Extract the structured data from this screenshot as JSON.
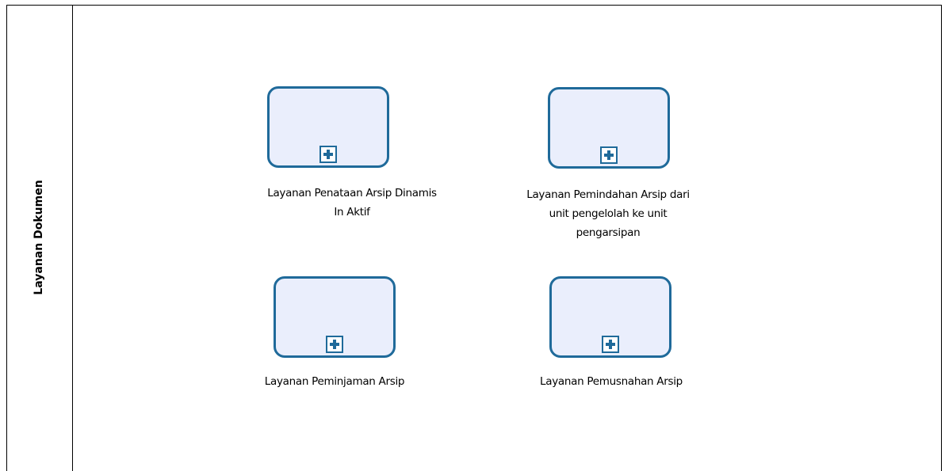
{
  "lane": {
    "title": "Layanan Dokumen"
  },
  "tasks": [
    {
      "label_lines": [
        "Layanan Penataan Arsip Dinamis",
        "In Aktif"
      ],
      "marker_icon": "plus-box-icon"
    },
    {
      "label_lines": [
        "Layanan Pemindahan Arsip dari",
        "unit pengelolah ke unit",
        "pengarsipan"
      ],
      "marker_icon": "plus-box-icon"
    },
    {
      "label_lines": [
        "Layanan Peminjaman Arsip"
      ],
      "marker_icon": "plus-box-icon"
    },
    {
      "label_lines": [
        "Layanan Pemusnahan Arsip"
      ],
      "marker_icon": "plus-box-icon"
    }
  ],
  "colors": {
    "task_fill": "#eaeefc",
    "task_stroke": "#1f6a9a",
    "line": "#000000"
  }
}
